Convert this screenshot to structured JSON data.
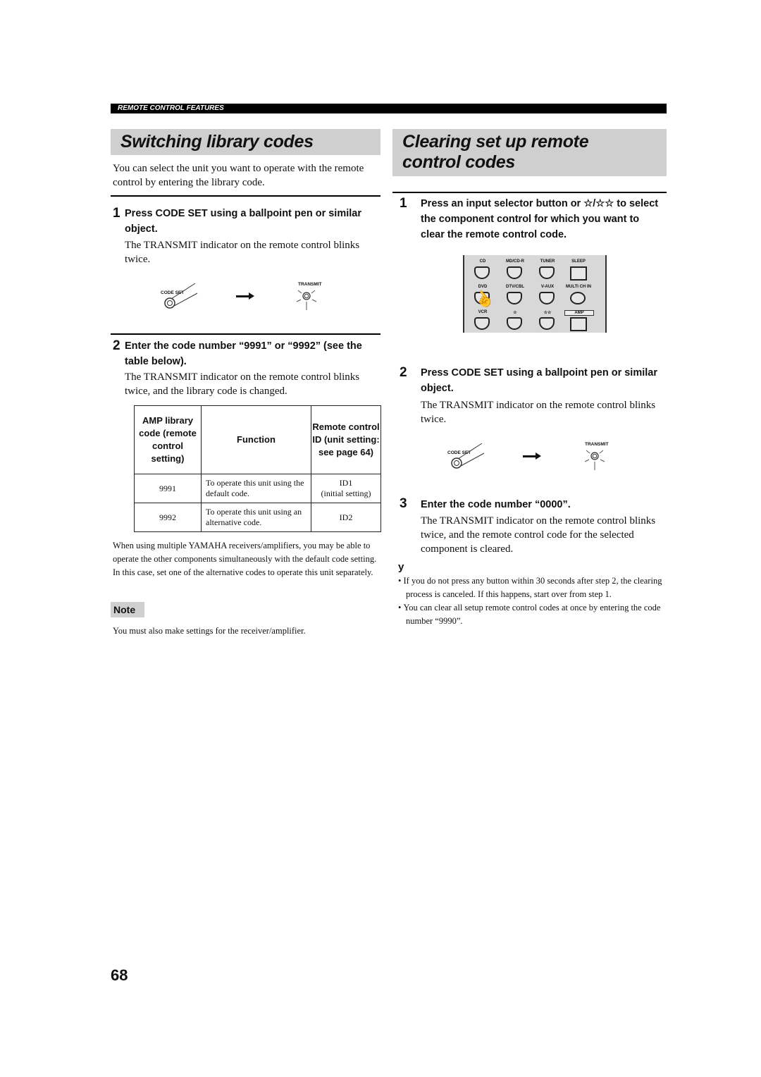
{
  "section_header": "REMOTE CONTROL FEATURES",
  "left": {
    "title": "Switching library codes",
    "intro": "You can select the unit you want to operate with the remote control by entering the library code.",
    "step1": {
      "number": "1",
      "heading": "Press CODE SET using a ballpoint pen or similar object.",
      "body": "The TRANSMIT indicator on the remote control blinks twice."
    },
    "illus": {
      "code_set": "CODE SET",
      "transmit": "TRANSMIT"
    },
    "step2": {
      "number": "2",
      "heading": "Enter the code number “9991” or “9992” (see the table below).",
      "body": "The TRANSMIT indicator on the remote control blinks twice, and the library code is changed."
    },
    "table": {
      "headers": [
        "AMP library code (remote control setting)",
        "Function",
        "Remote control ID (unit setting: see page 64)"
      ],
      "rows": [
        {
          "code": "9991",
          "function": "To operate this unit using the default code.",
          "id": "ID1",
          "id_note": "(initial setting)"
        },
        {
          "code": "9992",
          "function": "To operate this unit using an alternative code.",
          "id": "ID2",
          "id_note": ""
        }
      ]
    },
    "paragraph": "When using multiple YAMAHA receivers/amplifiers, you may be able to operate the other components simultaneously with the default code setting. In this case, set one of the alternative codes to operate this unit separately.",
    "note_label": "Note",
    "note_text": "You must also make settings for the receiver/amplifier."
  },
  "right": {
    "title": "Clearing set up remote control codes",
    "step1": {
      "number": "1",
      "heading": "Press an input selector button or ☆/☆☆ to select the component control for which you want to clear the remote control code."
    },
    "remote_buttons": [
      "CD",
      "MD/CD-R",
      "TUNER",
      "SLEEP",
      "DVD",
      "DTV/CBL",
      "V-AUX",
      "MULTI CH IN",
      "VCR",
      "☆",
      "☆☆",
      "AMP"
    ],
    "step2": {
      "number": "2",
      "heading": "Press CODE SET using a ballpoint pen or similar object.",
      "body": "The TRANSMIT indicator on the remote control blinks twice."
    },
    "illus": {
      "code_set": "CODE SET",
      "transmit": "TRANSMIT"
    },
    "step3": {
      "number": "3",
      "heading": "Enter the code number “0000”.",
      "body": "The TRANSMIT indicator on the remote control blinks twice, and the remote control code for the selected component is cleared."
    },
    "tip_symbol": "y",
    "tips": [
      "If you do not press any button within 30 seconds after step 2, the clearing process is canceled. If this happens, start over from step 1.",
      "You can clear all setup remote control codes at once by entering the code number “9990”."
    ]
  },
  "page_number": "68"
}
